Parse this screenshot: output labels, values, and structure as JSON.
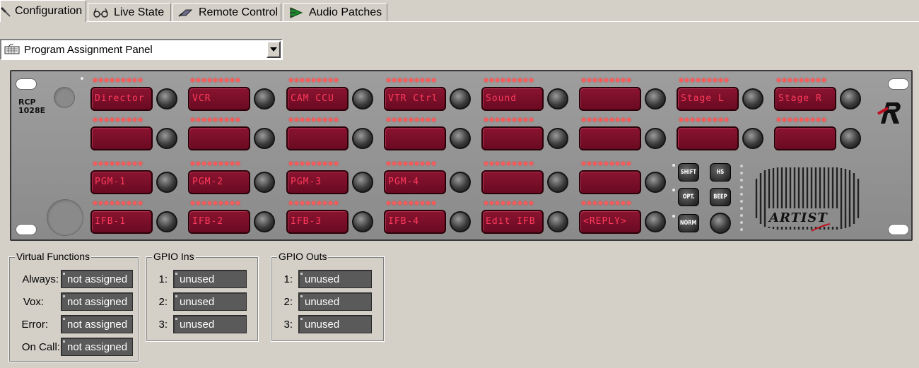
{
  "tabs": [
    {
      "label": "Configuration",
      "icon": "tools-icon",
      "active": true
    },
    {
      "label": "Live State",
      "icon": "glasses-icon",
      "active": false
    },
    {
      "label": "Remote Control",
      "icon": "remote-control-icon",
      "active": false
    },
    {
      "label": "Audio Patches",
      "icon": "audio-patch-icon",
      "active": false
    }
  ],
  "panel_select": {
    "value": "Program Assignment Panel",
    "icon": "keyboard-icon"
  },
  "device": {
    "model_line1": "RCP",
    "model_line2": "1028E",
    "brand": "ARTIST",
    "logo": "R",
    "keys": [
      [
        "Director",
        "VCR",
        "CAM CCU",
        "VTR Ctrl",
        "Sound",
        "",
        "Stage L",
        "Stage R"
      ],
      [
        "",
        "",
        "",
        "",
        "",
        "",
        "",
        ""
      ],
      [
        "PGM-1",
        "PGM-2",
        "PGM-3",
        "PGM-4",
        "",
        ""
      ],
      [
        "IFB-1",
        "IFB-2",
        "IFB-3",
        "IFB-4",
        "Edit IFB",
        "<REPLY>"
      ]
    ],
    "controls": {
      "shift": "SHIFT",
      "hs": "HS",
      "opt": "OPT.",
      "beep": "BEEP",
      "norm": "NORM"
    },
    "key_color": "#7a0f28",
    "key_text_color": "#ff3a5c"
  },
  "virtual_functions": {
    "title": "Virtual Functions",
    "rows": [
      {
        "label": "Always:",
        "value": "not assigned"
      },
      {
        "label": "Vox:",
        "value": "not assigned"
      },
      {
        "label": "Error:",
        "value": "not assigned"
      },
      {
        "label": "On Call:",
        "value": "not assigned"
      }
    ]
  },
  "gpio_ins": {
    "title": "GPIO Ins",
    "rows": [
      {
        "label": "1:",
        "value": "unused"
      },
      {
        "label": "2:",
        "value": "unused"
      },
      {
        "label": "3:",
        "value": "unused"
      }
    ]
  },
  "gpio_outs": {
    "title": "GPIO Outs",
    "rows": [
      {
        "label": "1:",
        "value": "unused"
      },
      {
        "label": "2:",
        "value": "unused"
      },
      {
        "label": "3:",
        "value": "unused"
      }
    ]
  }
}
